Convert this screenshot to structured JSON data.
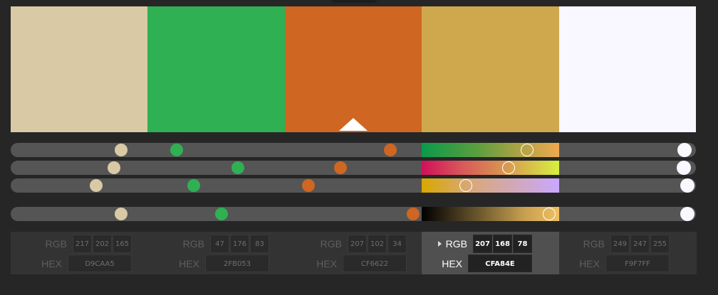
{
  "swatches": [
    {
      "rgb_label": "RGB",
      "hex_label": "HEX",
      "r": "217",
      "g": "202",
      "b": "165",
      "hex": "D9CAA5",
      "color": "#D9CAA5"
    },
    {
      "rgb_label": "RGB",
      "hex_label": "HEX",
      "r": "47",
      "g": "176",
      "b": "83",
      "hex": "2FB053",
      "color": "#2FB053"
    },
    {
      "rgb_label": "RGB",
      "hex_label": "HEX",
      "r": "207",
      "g": "102",
      "b": "34",
      "hex": "CF6622",
      "color": "#CF6622"
    },
    {
      "rgb_label": "RGB",
      "hex_label": "HEX",
      "r": "207",
      "g": "168",
      "b": "78",
      "hex": "CFA84E",
      "color": "#CFA84E"
    },
    {
      "rgb_label": "RGB",
      "hex_label": "HEX",
      "r": "249",
      "g": "247",
      "b": "255",
      "hex": "F9F7FF",
      "color": "#F9F7FF"
    }
  ],
  "selected_index": 3,
  "colors": {
    "background": "#262626",
    "track": "#555555",
    "panel": "#333333",
    "panel_active": "#505050"
  }
}
